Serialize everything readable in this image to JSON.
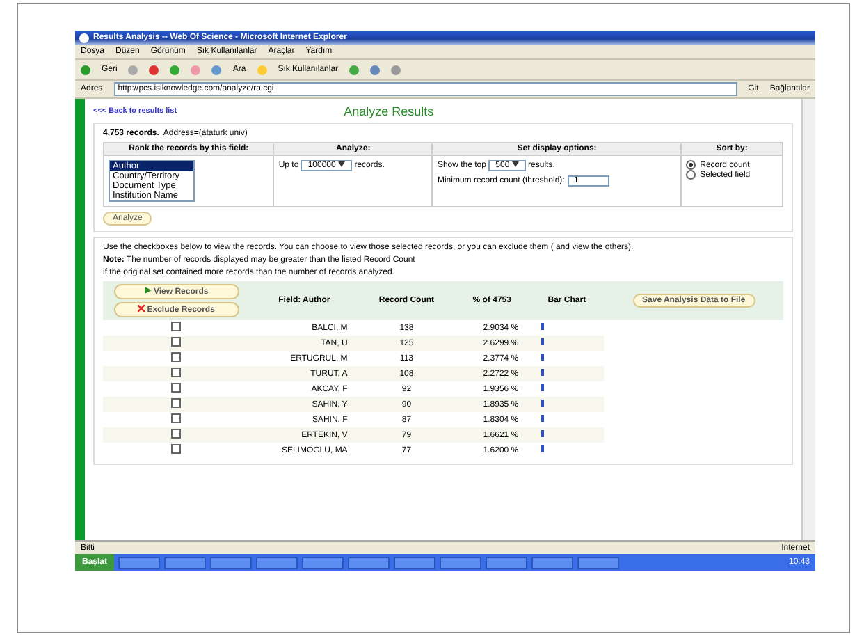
{
  "window": {
    "title": "Results Analysis -- Web Of Science - Microsoft Internet Explorer"
  },
  "menu": [
    "Dosya",
    "Düzen",
    "Görünüm",
    "Sık Kullanılanlar",
    "Araçlar",
    "Yardım"
  ],
  "toolbar": {
    "back": "Geri",
    "search": "Ara",
    "favorites": "Sık Kullanılanlar"
  },
  "address": {
    "label": "Adres",
    "url": "http://pcs.isiknowledge.com/analyze/ra.cgi",
    "go": "Git",
    "links": "Bağlantılar"
  },
  "page": {
    "back_link": "<<< Back to results list",
    "title": "Analyze Results",
    "summary_bold": "4,753 records.",
    "summary": "Address=(ataturk univ)",
    "options": {
      "headers": [
        "Rank the records by this field:",
        "Analyze:",
        "Set display options:",
        "Sort by:"
      ],
      "fields": [
        {
          "label": "Author",
          "selected": true
        },
        {
          "label": "Country/Territory",
          "selected": false
        },
        {
          "label": "Document Type",
          "selected": false
        },
        {
          "label": "Institution Name",
          "selected": false
        }
      ],
      "analyze_prefix": "Up to",
      "analyze_value": "100000",
      "analyze_suffix": "records.",
      "show_prefix": "Show the top",
      "show_value": "500",
      "show_suffix": "results.",
      "min_label": "Minimum record count (threshold):",
      "min_value": "1",
      "sort": [
        {
          "label": "Record count",
          "selected": true
        },
        {
          "label": "Selected field",
          "selected": false
        }
      ],
      "analyze_button": "Analyze"
    },
    "notes": [
      "Use the checkboxes below to view the records. You can choose to view those selected records, or you can exclude them ( and view the others).",
      "**Note:** The number of records displayed may be greater than the listed Record Count",
      "if the original set contained more records than the number of records analyzed."
    ],
    "view_button": "View Records",
    "exclude_button": "Exclude Records",
    "save_button": "Save Analysis Data to File",
    "columns": [
      "Field: Author",
      "Record Count",
      "% of 4753",
      "Bar Chart"
    ],
    "rows": [
      {
        "name": "BALCI, M",
        "count": "138",
        "percent": "2.9034 %",
        "checked": false
      },
      {
        "name": "TAN, U",
        "count": "125",
        "percent": "2.6299 %",
        "checked": false
      },
      {
        "name": "ERTUGRUL, M",
        "count": "113",
        "percent": "2.3774 %",
        "checked": false
      },
      {
        "name": "TURUT, A",
        "count": "108",
        "percent": "2.2722 %",
        "checked": false
      },
      {
        "name": "AKCAY, F",
        "count": "92",
        "percent": "1.9356 %",
        "checked": false
      },
      {
        "name": "SAHIN, Y",
        "count": "90",
        "percent": "1.8935 %",
        "checked": false
      },
      {
        "name": "SAHIN, F",
        "count": "87",
        "percent": "1.8304 %",
        "checked": false
      },
      {
        "name": "ERTEKIN, V",
        "count": "79",
        "percent": "1.6621 %",
        "checked": false
      },
      {
        "name": "SELIMOGLU, MA",
        "count": "77",
        "percent": "1.6200 %",
        "checked": false
      }
    ]
  },
  "status_bar": {
    "text": "Bitti",
    "zone": "Internet"
  },
  "taskbar": {
    "start": "Başlat",
    "clock": "10:43"
  }
}
